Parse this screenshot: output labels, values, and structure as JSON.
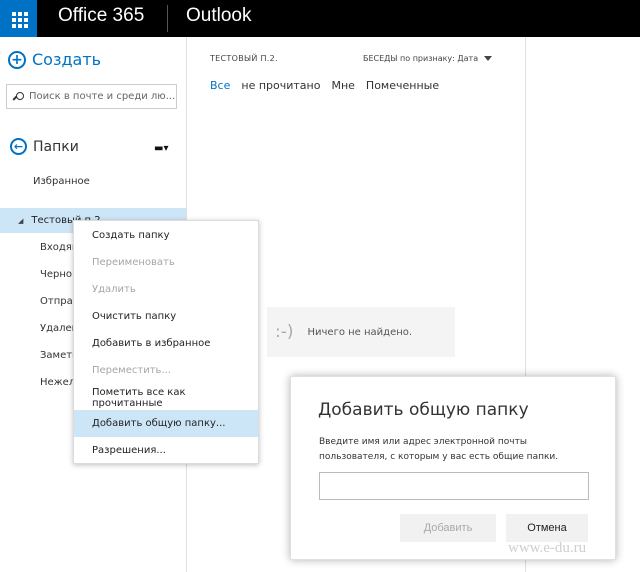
{
  "topbar": {
    "brand": "Office 365",
    "app": "Outlook"
  },
  "leftpane": {
    "new_label": "Создать",
    "search_placeholder": "Поиск в почте и среди лю...",
    "folders_label": "Папки",
    "favorites_label": "Избранное",
    "account_label": "Тестовый п.2",
    "folders": [
      "Входящ",
      "Черно",
      "Отпра",
      "Удален",
      "Заметк",
      "Нежел"
    ]
  },
  "msglist": {
    "title": "ТЕСТОВЫЙ П.2.",
    "sort_label": "БЕСЕДЫ по признаку: Дата",
    "filters": [
      "Все",
      "не прочитано",
      "Мне",
      "Помеченные"
    ],
    "empty_face": ":-)",
    "empty_text": "Ничего не найдено."
  },
  "context_menu": {
    "items": [
      {
        "label": "Создать папку"
      },
      {
        "label": "Переименовать"
      },
      {
        "label": "Удалить"
      },
      {
        "label": "Очистить папку"
      },
      {
        "label": "Добавить в избранное"
      },
      {
        "label": "Переместить..."
      },
      {
        "label": "Пометить все как прочитанные"
      },
      {
        "label": "Добавить общую папку..."
      },
      {
        "label": "Разрешения..."
      }
    ]
  },
  "dialog": {
    "title": "Добавить общую папку",
    "text": "Введите имя или адрес электронной почты пользователя, с которым у вас есть общие папки.",
    "input_value": "",
    "add_label": "Добавить",
    "cancel_label": "Отмена"
  },
  "watermark": "www.e-du.ru",
  "colors": {
    "accent": "#0072c6",
    "topbar": "#000000",
    "selection": "#cde6f7"
  }
}
